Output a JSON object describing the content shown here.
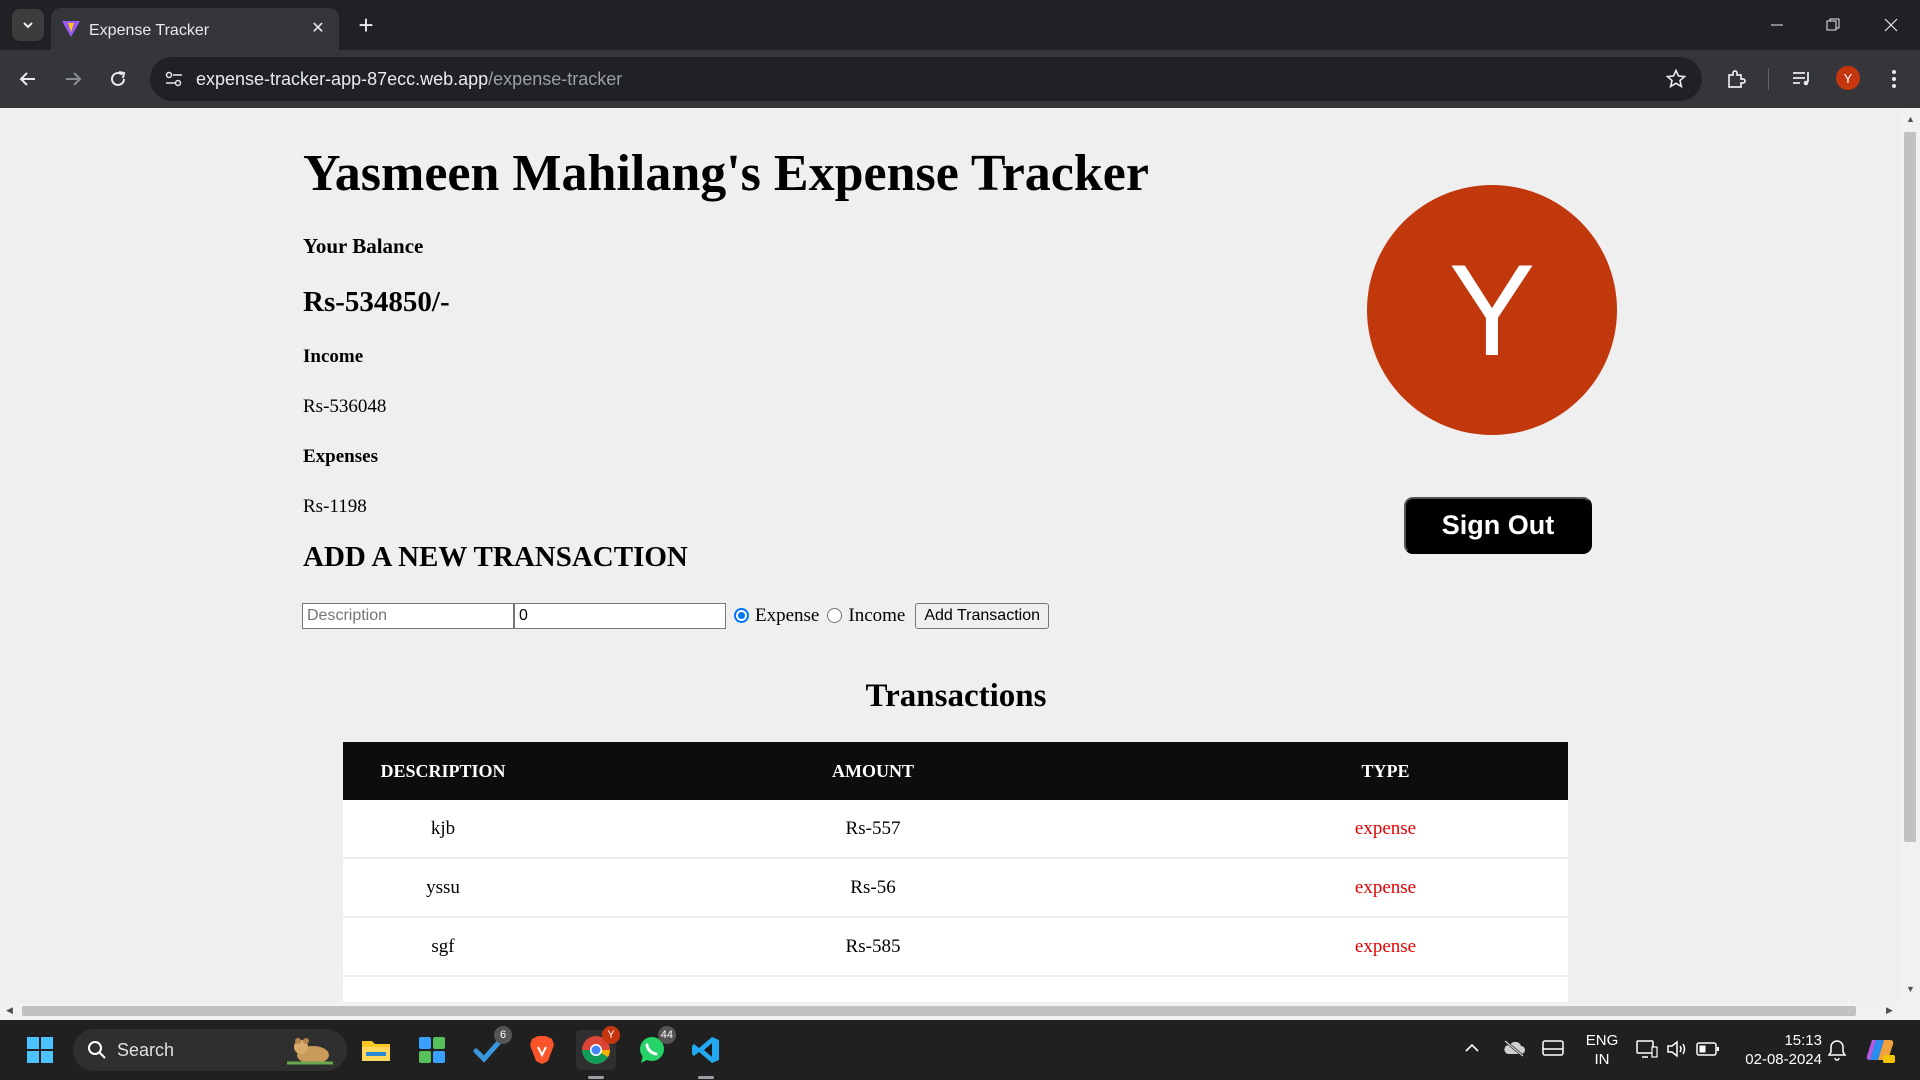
{
  "browser": {
    "tab_title": "Expense Tracker",
    "url_host": "expense-tracker-app-87ecc.web.app",
    "url_path": "/expense-tracker",
    "profile_initial": "Y"
  },
  "page": {
    "title": "Yasmeen Mahilang's Expense Tracker",
    "balance_label": "Your Balance",
    "balance_value": "Rs-534850/-",
    "income_label": "Income",
    "income_value": "Rs-536048",
    "expenses_label": "Expenses",
    "expenses_value": "Rs-1198",
    "add_heading": "ADD A NEW TRANSACTION",
    "form": {
      "description_placeholder": "Description",
      "amount_value": "0",
      "radio_expense_label": "Expense",
      "radio_income_label": "Income",
      "selected_type": "expense",
      "add_button_label": "Add Transaction"
    },
    "avatar_initial": "Y",
    "avatar_color": "#c1380c",
    "signout_label": "Sign Out",
    "transactions_heading": "Transactions",
    "table": {
      "headers": [
        "DESCRIPTION",
        "AMOUNT",
        "TYPE"
      ],
      "rows": [
        {
          "description": "kjb",
          "amount": "Rs-557",
          "type": "expense"
        },
        {
          "description": "yssu",
          "amount": "Rs-56",
          "type": "expense"
        },
        {
          "description": "sgf",
          "amount": "Rs-585",
          "type": "expense"
        }
      ]
    },
    "expense_color": "#e50000"
  },
  "taskbar": {
    "search_label": "Search",
    "apps": [
      "windows-start-icon",
      "file-explorer-icon",
      "widgets-icon",
      "todo-icon",
      "brave-icon",
      "chrome-icon",
      "whatsapp-icon",
      "vscode-icon"
    ],
    "todo_badge": "6",
    "whatsapp_badge": "44",
    "chrome_badge": "Y",
    "lang_top": "ENG",
    "lang_bottom": "IN",
    "time": "15:13",
    "date": "02-08-2024"
  }
}
